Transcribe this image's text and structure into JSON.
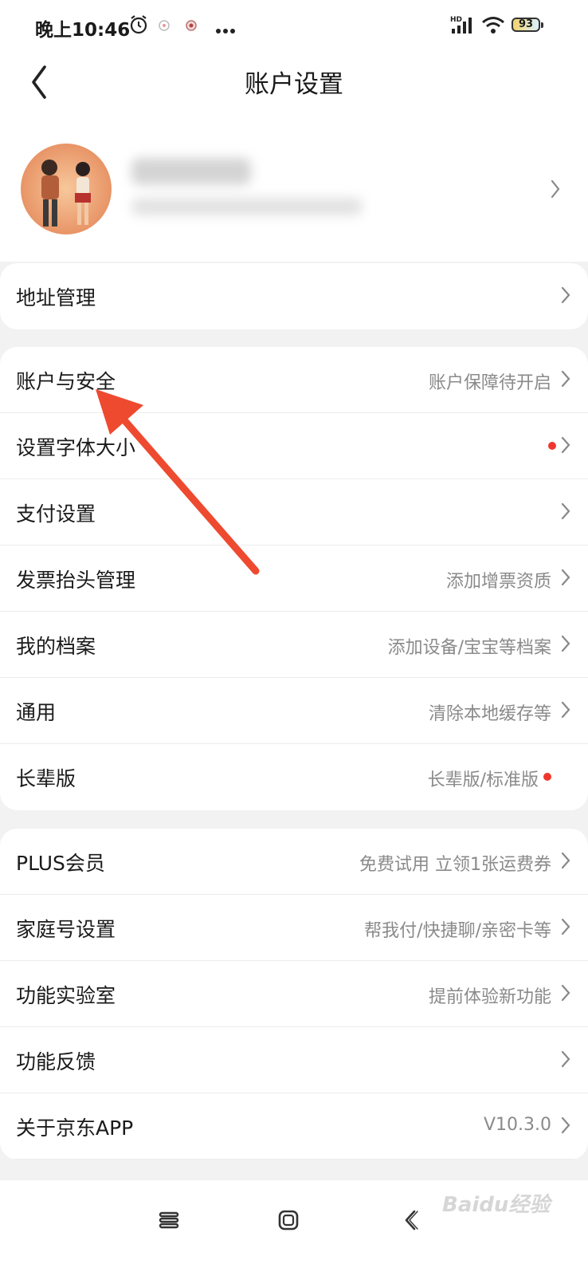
{
  "status_bar": {
    "time": "晚上10:46",
    "battery": "93",
    "icons": [
      "alarm-clock-icon",
      "app-notification-icon",
      "app-notification-icon",
      "more-dots-icon",
      "hd-signal-icon",
      "wifi-icon",
      "battery-icon"
    ]
  },
  "header": {
    "title": "账户设置",
    "back_icon": "back-chevron-icon"
  },
  "profile": {
    "avatar": "avatar-illustration",
    "chevron_icon": "chevron-right-icon"
  },
  "groups": [
    {
      "rows": [
        {
          "label": "地址管理",
          "value": "",
          "dot": false,
          "chevron": true
        }
      ]
    },
    {
      "rows": [
        {
          "label": "账户与安全",
          "value": "账户保障待开启",
          "dot": false,
          "chevron": true
        },
        {
          "label": "设置字体大小",
          "value": "",
          "dot": true,
          "chevron": true
        },
        {
          "label": "支付设置",
          "value": "",
          "dot": false,
          "chevron": true
        },
        {
          "label": "发票抬头管理",
          "value": "添加增票资质",
          "dot": false,
          "chevron": true
        },
        {
          "label": "我的档案",
          "value": "添加设备/宝宝等档案",
          "dot": false,
          "chevron": true
        },
        {
          "label": "通用",
          "value": "清除本地缓存等",
          "dot": false,
          "chevron": true
        },
        {
          "label": "长辈版",
          "value": "长辈版/标准版",
          "dot": true,
          "chevron": false
        }
      ]
    },
    {
      "rows": [
        {
          "label": "PLUS会员",
          "value": "免费试用 立领1张运费券",
          "dot": false,
          "chevron": true
        },
        {
          "label": "家庭号设置",
          "value": "帮我付/快捷聊/亲密卡等",
          "dot": false,
          "chevron": true
        },
        {
          "label": "功能实验室",
          "value": "提前体验新功能",
          "dot": false,
          "chevron": true
        },
        {
          "label": "功能反馈",
          "value": "",
          "dot": false,
          "chevron": true
        },
        {
          "label": "关于京东APP",
          "value": "V10.3.0",
          "dot": false,
          "chevron": true
        }
      ]
    }
  ],
  "nav_bar": {
    "buttons": [
      "menu-icon",
      "home-square-icon",
      "back-icon"
    ]
  },
  "watermark": "Baidu经验",
  "colors": {
    "accent_red": "#f0372d",
    "arrow_red": "#ee4a30",
    "background": "#f2f2f2",
    "card": "#ffffff",
    "secondary_text": "#8a8a8a"
  }
}
